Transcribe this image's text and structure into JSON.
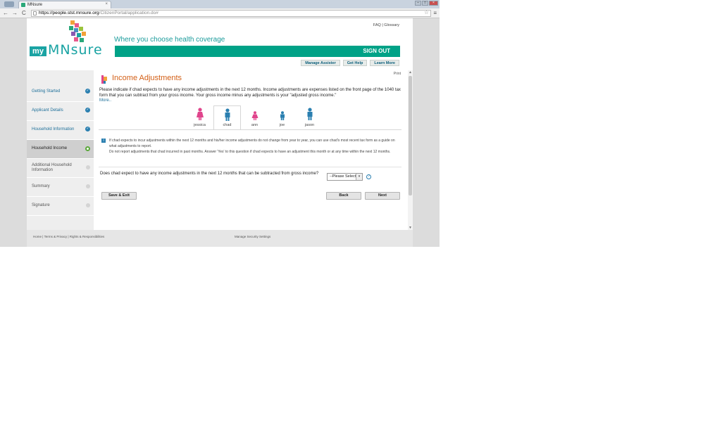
{
  "browser": {
    "tab_title": "MNsure",
    "tab_close": "×",
    "url_host": "https://people.stst.mnsure.org",
    "url_path": "/CitizenPortal/application.do#",
    "back": "←",
    "forward": "→",
    "reload": "C",
    "star": "☆",
    "menu": "≡",
    "win_min": "–",
    "win_max": "□",
    "win_close": "×"
  },
  "header": {
    "logo_my": "my",
    "logo_mnsure": "MNsure",
    "tagline": "Where you choose health coverage",
    "faq": "FAQ",
    "separator": "|",
    "glossary": "Glossary",
    "sign_out": "SIGN OUT",
    "buttons": [
      "Manage Assister",
      "Get Help",
      "Learn More"
    ]
  },
  "sidebar": {
    "items": [
      {
        "label": "Getting Started",
        "status": "complete"
      },
      {
        "label": "Applicant Details",
        "status": "complete"
      },
      {
        "label": "Household Information",
        "status": "complete"
      },
      {
        "label": "Household Income",
        "status": "active"
      },
      {
        "label": "Additional Household Information",
        "status": "pending"
      },
      {
        "label": "Summary",
        "status": "pending"
      },
      {
        "label": "Signature",
        "status": "pending"
      }
    ],
    "check_glyph": "✓"
  },
  "main": {
    "print": "Print",
    "title": "Income Adjustments",
    "intro": "Please indicate if chad expects to have any income adjustments in the next 12 months. Income adjustments are expenses listed on the front page of the 1040 tax form that you can subtract from your gross income. Your gross income minus any adjustments is your \"adjusted gross income.\"",
    "more": "More..",
    "people": [
      {
        "name": "jessica",
        "gender": "female",
        "color": "#e0448c",
        "size": "adult",
        "selected": false
      },
      {
        "name": "chad",
        "gender": "male",
        "color": "#2a7fb0",
        "size": "adult",
        "selected": true
      },
      {
        "name": "ann",
        "gender": "female",
        "color": "#e0448c",
        "size": "child",
        "selected": false
      },
      {
        "name": "joe",
        "gender": "male",
        "color": "#2a7fb0",
        "size": "child",
        "selected": false
      },
      {
        "name": "jason",
        "gender": "male",
        "color": "#2a7fb0",
        "size": "adult",
        "selected": false
      }
    ],
    "info_glyph": "i",
    "info_line1": "If chad expects to incur adjustments within the next 12 months and his/her income adjustments do not change from year to year, you can use chad's most recent tax form as a guide on what adjustments to report.",
    "info_line2": "Do not report adjustments that chad incurred in past months. Answer 'Yes' to this question if chad expects to have an adjustment this month or at any time within the next 12 months.",
    "question": "Does chad expect to have any income adjustments in the next 12 months that can be subtracted from gross income?",
    "select_value": "--Please Select--",
    "select_arrow": "▾",
    "help_glyph": "?",
    "save_exit": "Save & Exit",
    "back": "Back",
    "next": "Next"
  },
  "scroll": {
    "up": "▲",
    "down": "▼"
  },
  "footer": {
    "links": "Home | Terms & Privacy | Rights & Responsibilities",
    "security": "Manage Security Settings"
  },
  "colors": {
    "brand_teal": "#1aa3a3",
    "signout_green": "#00a287",
    "title_orange": "#d35f16",
    "link_blue": "#1d6f99",
    "female_pink": "#e0448c",
    "male_blue": "#2a7fb0"
  }
}
